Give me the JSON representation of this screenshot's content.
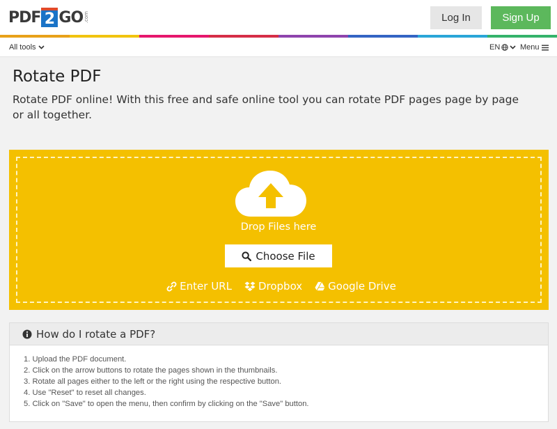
{
  "header": {
    "logo": {
      "pdf": "PDF",
      "two": "2",
      "go": "GO",
      "com": ".com"
    },
    "login_label": "Log In",
    "signup_label": "Sign Up"
  },
  "colors": {
    "stripe": [
      "#e8a11a",
      "#f1c40f",
      "#e6176d",
      "#d62e47",
      "#8e44ad",
      "#3464c4",
      "#2aa6d8",
      "#35b36b"
    ],
    "upload_bg": "#f4c000",
    "signup_bg": "#5cb85c"
  },
  "subnav": {
    "all_tools_label": "All tools",
    "lang_label": "EN",
    "menu_label": "Menu"
  },
  "page": {
    "title": "Rotate PDF",
    "description": "Rotate PDF online! With this free and safe online tool you can rotate PDF pages page by page or all together."
  },
  "upload": {
    "drop_text": "Drop Files here",
    "choose_label": "Choose File",
    "url_label": "Enter URL",
    "dropbox_label": "Dropbox",
    "gdrive_label": "Google Drive"
  },
  "howto": {
    "title": "How do I rotate a PDF?",
    "steps": [
      "1. Upload the PDF document.",
      "2. Click on the arrow buttons to rotate the pages shown in the thumbnails.",
      "3. Rotate all pages either to the left or the right using the respective button.",
      "4. Use \"Reset\" to reset all changes.",
      "5. Click on \"Save\" to open the menu, then confirm by clicking on the \"Save\" button."
    ]
  },
  "icons": {
    "upload": "cloud-upload-icon",
    "search": "search-icon",
    "link": "link-icon",
    "dropbox": "dropbox-icon",
    "gdrive": "google-drive-icon",
    "info": "info-icon",
    "chevron": "chevron-down-icon",
    "globe": "globe-icon",
    "hamburger": "hamburger-icon"
  }
}
